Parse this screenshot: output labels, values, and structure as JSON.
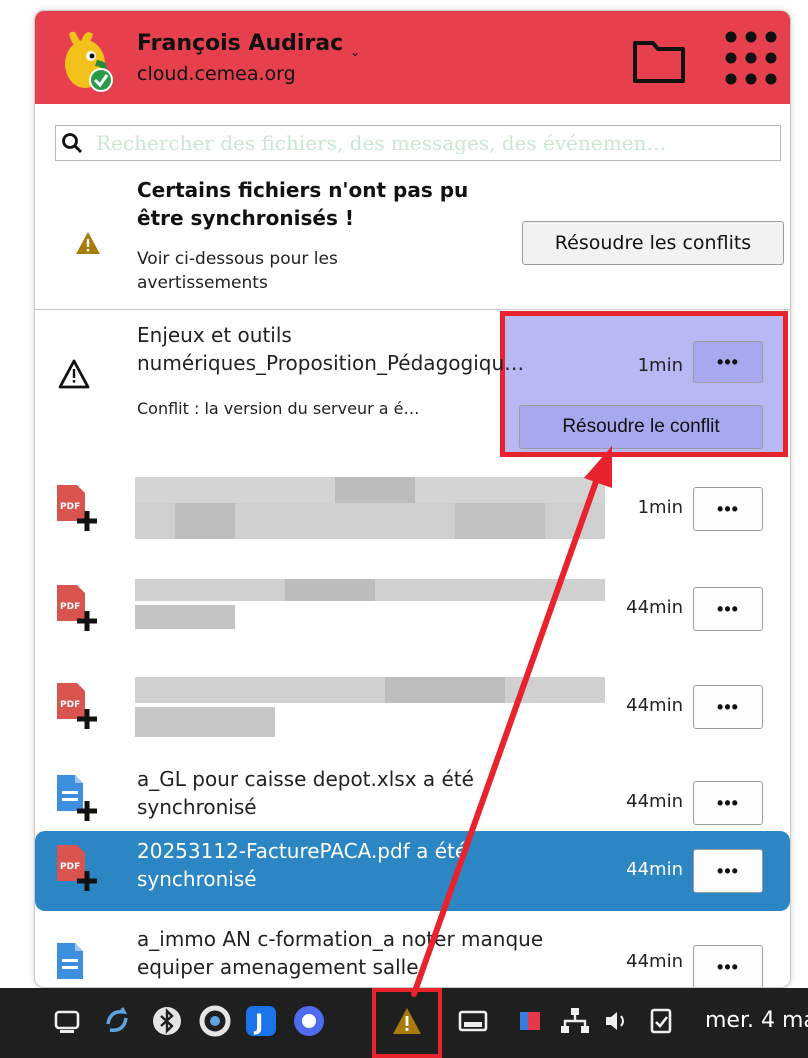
{
  "account": {
    "name": "François Audirac",
    "server": "cloud.cemea.org",
    "dropdown": "⌄"
  },
  "search": {
    "placeholder": "Rechercher des fichiers, des messages, des événemen…"
  },
  "sync_warning": {
    "title": "Certains fichiers n'ont pas pu être synchronisés !",
    "text": "Voir ci-dessous pour les avertissements",
    "button_label": "Résoudre les conflits"
  },
  "activities": [
    {
      "icon": "warning-outline-icon",
      "title": "Enjeux et outils numériques_Proposition_Pédagogiqu…",
      "subtitle": "Conflit : la version du serveur a é…",
      "time": "1min",
      "more_label": "•••",
      "action_label": "Résoudre le conflit"
    },
    {
      "icon": "pdf-file-icon",
      "title": "",
      "time": "1min",
      "more_label": "•••"
    },
    {
      "icon": "pdf-file-icon",
      "title": "",
      "time": "44min",
      "more_label": "•••"
    },
    {
      "icon": "pdf-file-icon",
      "title": "",
      "time": "44min",
      "more_label": "•••"
    },
    {
      "icon": "document-file-icon",
      "title": "a_GL pour caisse depot.xlsx a été synchronisé",
      "time": "44min",
      "more_label": "•••"
    },
    {
      "icon": "pdf-file-icon",
      "title": "20253112-FacturePACA.pdf a été synchronisé",
      "time": "44min",
      "more_label": "•••",
      "selected": true
    },
    {
      "icon": "document-file-icon",
      "title": "a_immo AN c-formation_a noter manque equiper amenagement salle",
      "time": "44min",
      "more_label": "•••"
    }
  ],
  "taskbar": {
    "clock": "mer. 4 ma",
    "tray_icons": [
      "chat-icon",
      "sync-client-icon",
      "bluetooth-icon",
      "keepassxc-icon",
      "joplin-icon",
      "gear-app-icon",
      "nextcloud-warning-icon",
      "tray-window-icon",
      "flag-icon",
      "network-icon",
      "volume-icon",
      "clipboard-icon"
    ]
  },
  "colors": {
    "header": "#e6404f",
    "highlight_bg": "#b8b8f4",
    "annotation_red": "#e8232e",
    "selected_row": "#2d86c4",
    "taskbar": "#1f1f1f"
  }
}
